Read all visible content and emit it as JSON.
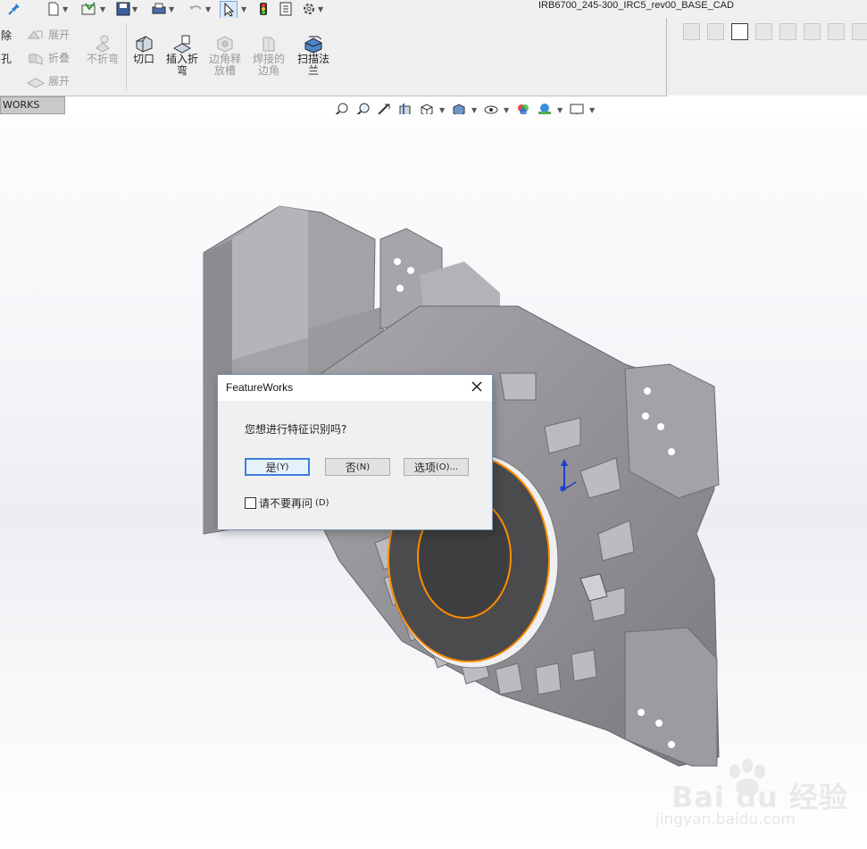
{
  "document": {
    "title": "IRB6700_245-300_IRC5_rev00_BASE_CAD"
  },
  "ribbon": {
    "left_cut_labels": [
      "除",
      "孔"
    ],
    "small_items": [
      {
        "label": "展开",
        "enabled": false
      },
      {
        "label": "折叠",
        "enabled": false
      },
      {
        "label": "展开",
        "enabled": false
      }
    ],
    "big_items": [
      {
        "label_line1": "不折弯",
        "label_line2": "",
        "enabled": false
      },
      {
        "label_line1": "切口",
        "label_line2": "",
        "enabled": true
      },
      {
        "label_line1": "插入折",
        "label_line2": "弯",
        "enabled": true
      },
      {
        "label_line1": "边角释",
        "label_line2": "放槽",
        "enabled": false
      },
      {
        "label_line1": "焊接的",
        "label_line2": "边角",
        "enabled": false
      },
      {
        "label_line1": "扫描法",
        "label_line2": "兰",
        "enabled": true
      }
    ]
  },
  "tabs": {
    "active": "WORKS MBD"
  },
  "dialog": {
    "title": "FeatureWorks",
    "message": "您想进行特征识别吗?",
    "yes_label": "是",
    "yes_key": "(Y)",
    "no_label": "否",
    "no_key": "(N)",
    "options_label": "选项",
    "options_key": "(O)...",
    "checkbox_label": "请不要再问",
    "checkbox_key": "(D)",
    "checkbox_checked": false
  },
  "watermark": {
    "brand": "Bai du 经验",
    "url": "jingyan.baidu.com"
  },
  "colors": {
    "accent": "#3c7fd9",
    "edge_highlight": "#ff8c00"
  }
}
